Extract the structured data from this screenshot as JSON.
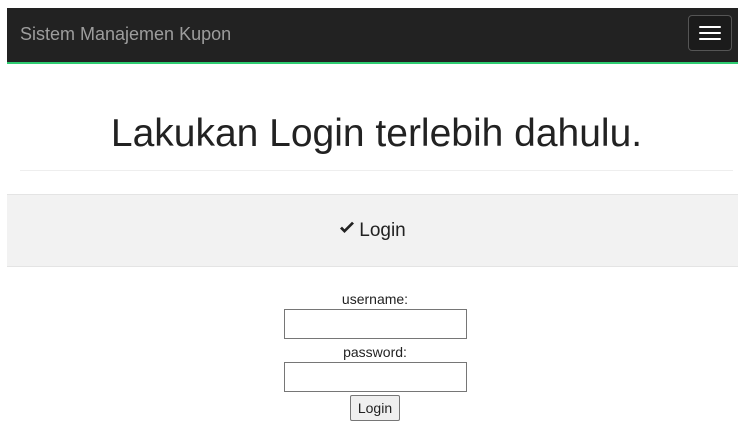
{
  "navbar": {
    "brand": "Sistem Manajemen Kupon",
    "toggle_icon": "hamburger-menu-icon"
  },
  "header": {
    "title": "Lakukan Login terlebih dahulu."
  },
  "panel": {
    "icon": "checkmark-icon",
    "heading": "Login"
  },
  "form": {
    "username_label": "username:",
    "username_value": "",
    "password_label": "password:",
    "password_value": "",
    "submit_label": "Login"
  },
  "colors": {
    "navbar_bg": "#222222",
    "navbar_accent": "#2ecc71",
    "panel_bg": "#f2f2f2"
  }
}
